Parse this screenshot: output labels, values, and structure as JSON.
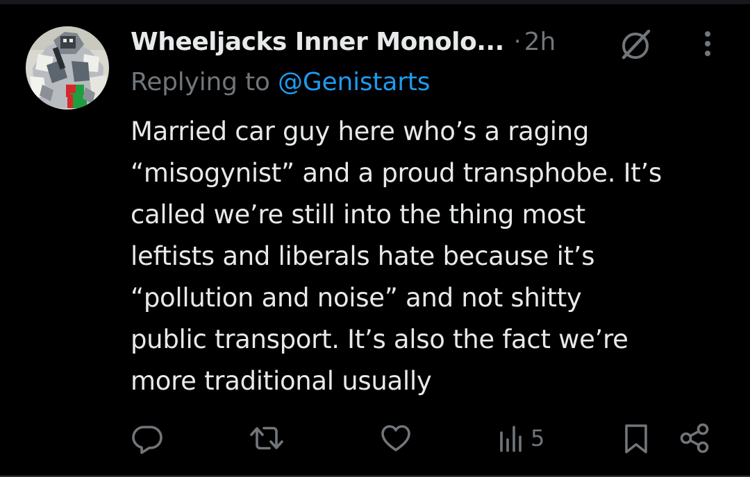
{
  "tweet": {
    "display_name": "Wheeljacks Inner Monolo...",
    "separator": "·",
    "timestamp": "2h",
    "reply_prefix": "Replying to ",
    "reply_handle": "@Genistarts",
    "text_lines": [
      "Married car guy here who’s a raging",
      "“misogynist” and a proud transphobe. It’s",
      "called we’re still into the thing most",
      "leftists and liberals hate because it’s",
      "“pollution and noise” and not shitty",
      "public transport. It’s also the fact we’re",
      "more traditional usually"
    ]
  },
  "actions": {
    "views_count": "5"
  },
  "icons": {
    "avatar": "avatar-robot-image",
    "grok": "grok-icon",
    "more": "more-vertical-icon",
    "reply": "reply-icon",
    "retweet": "retweet-icon",
    "like": "like-icon",
    "views": "views-icon",
    "bookmark": "bookmark-icon",
    "share": "share-icon"
  },
  "colors": {
    "background": "#000000",
    "text": "#e7e9ea",
    "muted": "#71767b",
    "link": "#1d9bf0"
  }
}
